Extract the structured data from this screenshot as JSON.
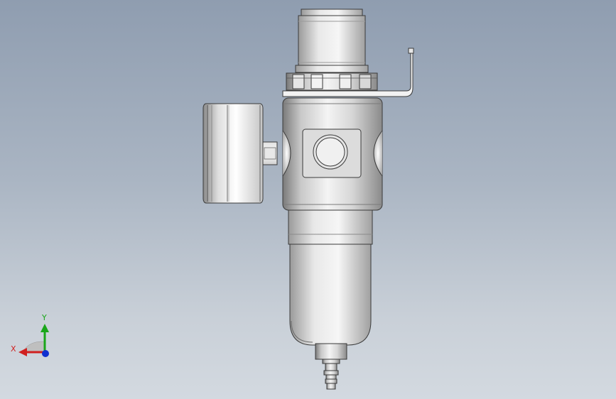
{
  "viewport": {
    "background_top": "#8f9db0",
    "background_bottom": "#d3d9e0"
  },
  "model": {
    "part_colors": {
      "metal_light": "#f2f2f2",
      "metal_mid": "#cfcfcf",
      "metal_dark": "#8c8c8c",
      "edge": "#3a3a3a"
    }
  },
  "triad": {
    "x_label": "X",
    "y_label": "Y",
    "x_color": "#d02020",
    "y_color": "#1aa61a",
    "z_color": "#1030d0"
  }
}
